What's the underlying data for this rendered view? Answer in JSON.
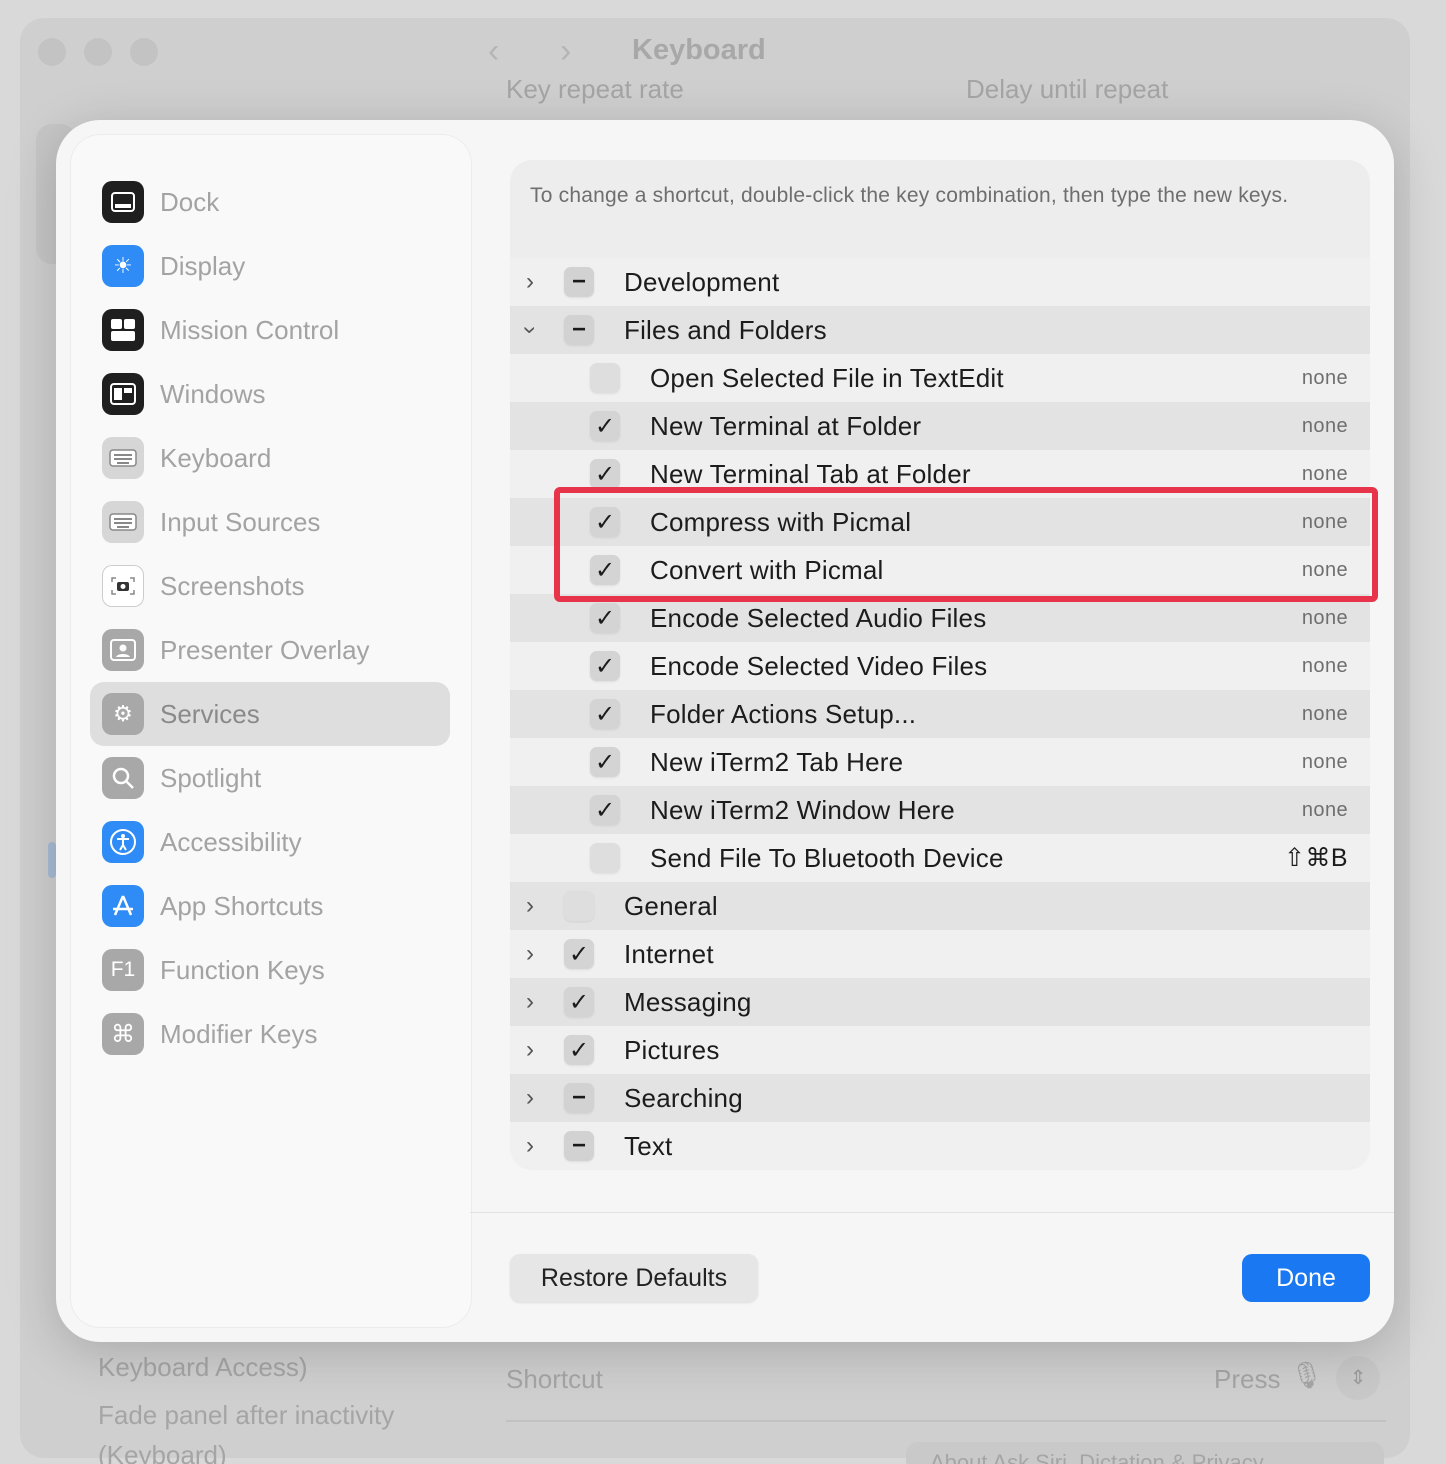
{
  "background": {
    "window_title": "Keyboard",
    "label_left": "Key repeat rate",
    "label_right": "Delay until repeat",
    "bottom_left_1": "Keyboard Access)",
    "bottom_left_2": "Fade panel after inactivity",
    "bottom_left_3": "(Keyboard)",
    "shortcut_label": "Shortcut",
    "shortcut_value": "Press",
    "pill_text": "About Ask Siri, Dictation & Privacy"
  },
  "sidebar": {
    "items": [
      {
        "label": "Dock",
        "icon": "dock-icon"
      },
      {
        "label": "Display",
        "icon": "display-icon"
      },
      {
        "label": "Mission Control",
        "icon": "mission-control-icon"
      },
      {
        "label": "Windows",
        "icon": "windows-icon"
      },
      {
        "label": "Keyboard",
        "icon": "keyboard-icon"
      },
      {
        "label": "Input Sources",
        "icon": "input-sources-icon"
      },
      {
        "label": "Screenshots",
        "icon": "screenshots-icon"
      },
      {
        "label": "Presenter Overlay",
        "icon": "presenter-overlay-icon"
      },
      {
        "label": "Services",
        "icon": "services-icon",
        "selected": true
      },
      {
        "label": "Spotlight",
        "icon": "spotlight-icon"
      },
      {
        "label": "Accessibility",
        "icon": "accessibility-icon"
      },
      {
        "label": "App Shortcuts",
        "icon": "app-shortcuts-icon"
      },
      {
        "label": "Function Keys",
        "icon": "function-keys-icon"
      },
      {
        "label": "Modifier Keys",
        "icon": "modifier-keys-icon"
      }
    ]
  },
  "panel": {
    "intro": "To change a shortcut, double-click the key combination, then type the new keys.",
    "rows": [
      {
        "kind": "group",
        "label": "Development",
        "state": "mixed",
        "expanded": false
      },
      {
        "kind": "group",
        "label": "Files and Folders",
        "state": "mixed",
        "expanded": true
      },
      {
        "kind": "item",
        "label": "Open Selected File in TextEdit",
        "state": "off",
        "shortcut": "none"
      },
      {
        "kind": "item",
        "label": "New Terminal at Folder",
        "state": "on",
        "shortcut": "none"
      },
      {
        "kind": "item",
        "label": "New Terminal Tab at Folder",
        "state": "on",
        "shortcut": "none"
      },
      {
        "kind": "item",
        "label": "Compress with Picmal",
        "state": "on",
        "shortcut": "none"
      },
      {
        "kind": "item",
        "label": "Convert with Picmal",
        "state": "on",
        "shortcut": "none"
      },
      {
        "kind": "item",
        "label": "Encode Selected Audio Files",
        "state": "on",
        "shortcut": "none"
      },
      {
        "kind": "item",
        "label": "Encode Selected Video Files",
        "state": "on",
        "shortcut": "none"
      },
      {
        "kind": "item",
        "label": "Folder Actions Setup...",
        "state": "on",
        "shortcut": "none"
      },
      {
        "kind": "item",
        "label": "New iTerm2 Tab Here",
        "state": "on",
        "shortcut": "none"
      },
      {
        "kind": "item",
        "label": "New iTerm2 Window Here",
        "state": "on",
        "shortcut": "none"
      },
      {
        "kind": "item",
        "label": "Send File To Bluetooth Device",
        "state": "off",
        "shortcut": "⇧⌘B"
      },
      {
        "kind": "group",
        "label": "General",
        "state": "off",
        "expanded": false
      },
      {
        "kind": "group",
        "label": "Internet",
        "state": "on",
        "expanded": false
      },
      {
        "kind": "group",
        "label": "Messaging",
        "state": "on",
        "expanded": false
      },
      {
        "kind": "group",
        "label": "Pictures",
        "state": "on",
        "expanded": false
      },
      {
        "kind": "group",
        "label": "Searching",
        "state": "mixed",
        "expanded": false
      },
      {
        "kind": "group",
        "label": "Text",
        "state": "mixed",
        "expanded": false
      }
    ]
  },
  "buttons": {
    "restore": "Restore Defaults",
    "done": "Done"
  },
  "colors": {
    "accent": "#1a78f2",
    "highlight": "#e8344a"
  }
}
